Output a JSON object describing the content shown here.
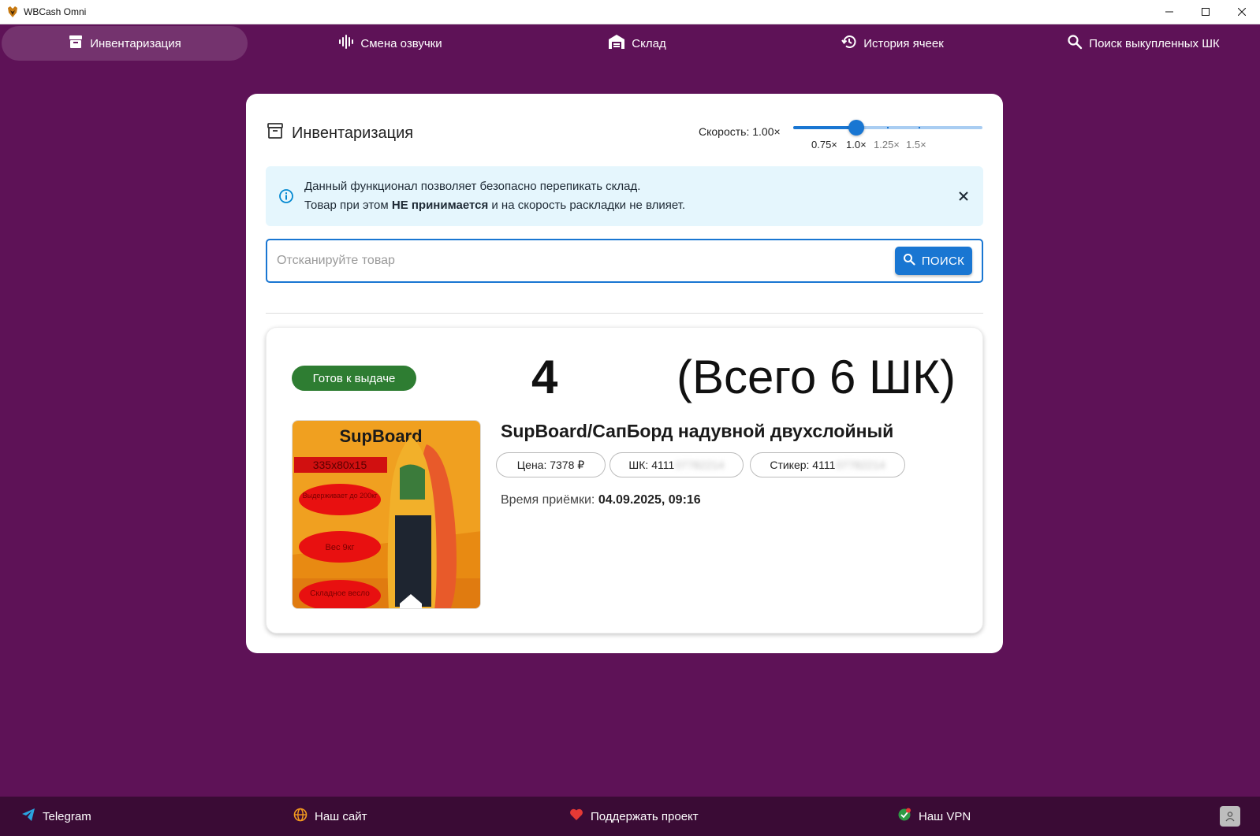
{
  "window": {
    "title": "WBCash Omni"
  },
  "nav": {
    "items": [
      {
        "label": "Инвентаризация",
        "icon": "archive-icon"
      },
      {
        "label": "Смена озвучки",
        "icon": "waveform-icon"
      },
      {
        "label": "Склад",
        "icon": "warehouse-icon"
      },
      {
        "label": "История ячеек",
        "icon": "history-icon"
      },
      {
        "label": "Поиск выкупленных ШК",
        "icon": "search-icon"
      }
    ],
    "active_index": 0
  },
  "card": {
    "title": "Инвентаризация",
    "speed": {
      "label": "Скорость: 1.00×",
      "ticks": [
        "0.75×",
        "1.0×",
        "1.25×",
        "1.5×"
      ],
      "min": 0.75,
      "max": 1.5,
      "value": 1.0
    },
    "alert": {
      "line1": "Данный функционал позволяет безопасно перепикать склад.",
      "line2_prefix": "Товар при этом ",
      "line2_bold": "НЕ принимается",
      "line2_suffix": " и на скорость раскладки не влияет."
    },
    "search": {
      "placeholder": "Отсканируйте товар",
      "value": "",
      "button_label": "ПОИСК"
    },
    "result": {
      "status": "Готов к выдаче",
      "cell_number": "4",
      "total": "(Всего 6 ШК)",
      "product_name": "SupBoard/СапБорд надувной двухслойный",
      "price": "Цена: 7378 ₽",
      "barcode_prefix": "ШК: 4111",
      "barcode_hidden": "07782214",
      "sticker_prefix": "Стикер: 4111",
      "sticker_hidden": "07782214",
      "receive_label": "Время приёмки: ",
      "receive_value": "04.09.2025, 09:16",
      "image": {
        "heading": "SupBoard",
        "size": "335x80x15",
        "badges": [
          "Выдерживает до 200кг",
          "Вес 9кг",
          "Складное весло"
        ]
      }
    }
  },
  "footer": {
    "items": [
      {
        "label": "Telegram",
        "icon": "telegram-icon"
      },
      {
        "label": "Наш сайт",
        "icon": "globe-icon"
      },
      {
        "label": "Поддержать проект",
        "icon": "heart-icon"
      },
      {
        "label": "Наш VPN",
        "icon": "vpn-icon"
      }
    ]
  },
  "colors": {
    "background": "#5e1257",
    "footer": "#3a0b35",
    "accent": "#1976d2",
    "status_green": "#2e7d32",
    "alert_bg": "#e5f6fd"
  }
}
